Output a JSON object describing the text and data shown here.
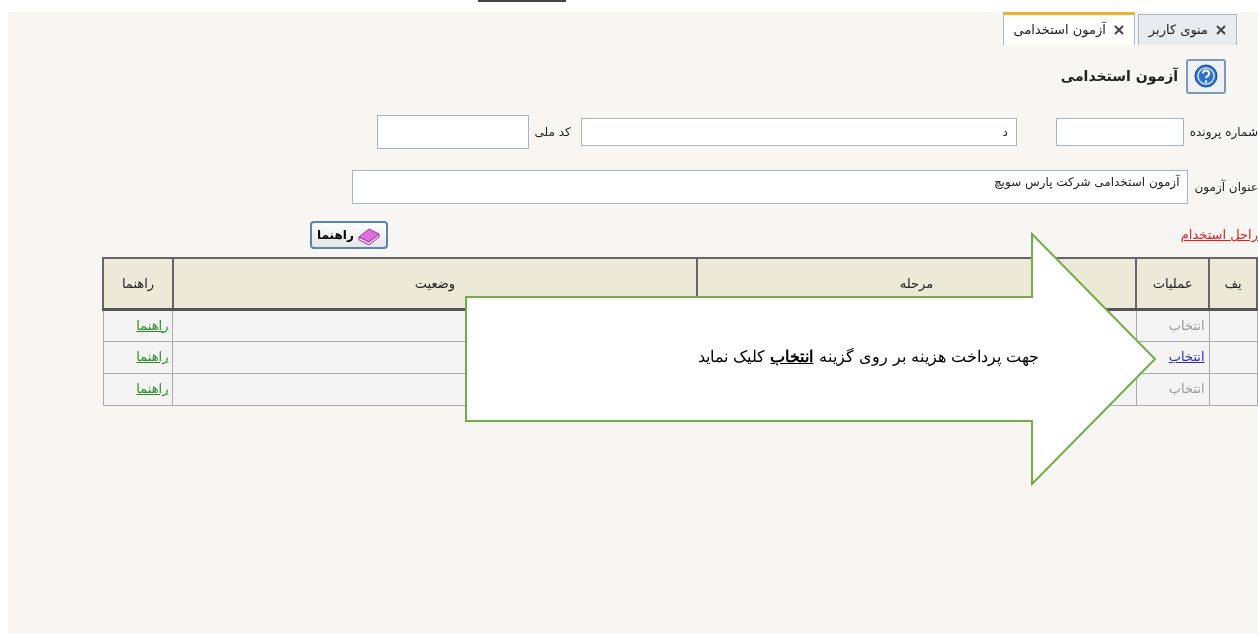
{
  "tabs": [
    {
      "label": "منوی کاربر",
      "selected": false
    },
    {
      "label": "آزمون استخدامی",
      "selected": true
    }
  ],
  "page_title": "آزمون استخدامی",
  "form": {
    "file_number_label": "شماره پرونده",
    "name_value": "د",
    "national_code_label": "کد ملی",
    "exam_title_label": "عنوان آزمون",
    "exam_title_value": "آزمون استخدامی شرکت پارس سویچ"
  },
  "stages_link": "راحل استخدام",
  "help_button": "راهنما",
  "table": {
    "columns": [
      "یف",
      "عملیات",
      "مرحله",
      "وضعیت",
      "راهنما"
    ],
    "rows": [
      {
        "action": "انتخاب",
        "enabled": false,
        "guide": "راهنما"
      },
      {
        "action": "انتخاب",
        "enabled": true,
        "guide": "راهنما"
      },
      {
        "action": "انتخاب",
        "enabled": false,
        "guide": "راهنما"
      }
    ]
  },
  "callout": {
    "text": "جهت پرداخت هزینه بر روی گزینه **انتخاب** کلیک نماید"
  }
}
